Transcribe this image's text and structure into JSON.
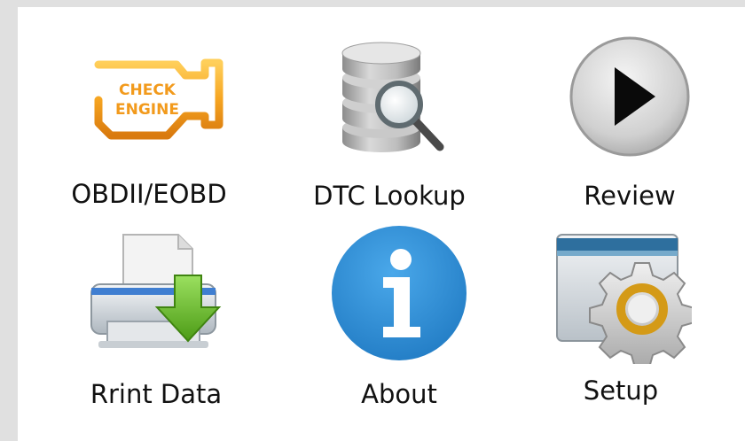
{
  "menu": {
    "items": [
      {
        "label": "OBDII/EOBD",
        "icon": "check-engine-icon"
      },
      {
        "label": "DTC Lookup",
        "icon": "database-search-icon"
      },
      {
        "label": "Review",
        "icon": "play-icon"
      },
      {
        "label": "Rrint Data",
        "icon": "printer-download-icon"
      },
      {
        "label": "About",
        "icon": "info-icon"
      },
      {
        "label": "Setup",
        "icon": "settings-gear-icon"
      }
    ]
  },
  "colors": {
    "background": "#e0e0e0",
    "panel": "#ffffff",
    "check_engine_orange": "#f29a1c",
    "info_blue": "#2b8fd6",
    "download_green": "#6bbf2a",
    "gear_gold": "#d49a17"
  }
}
